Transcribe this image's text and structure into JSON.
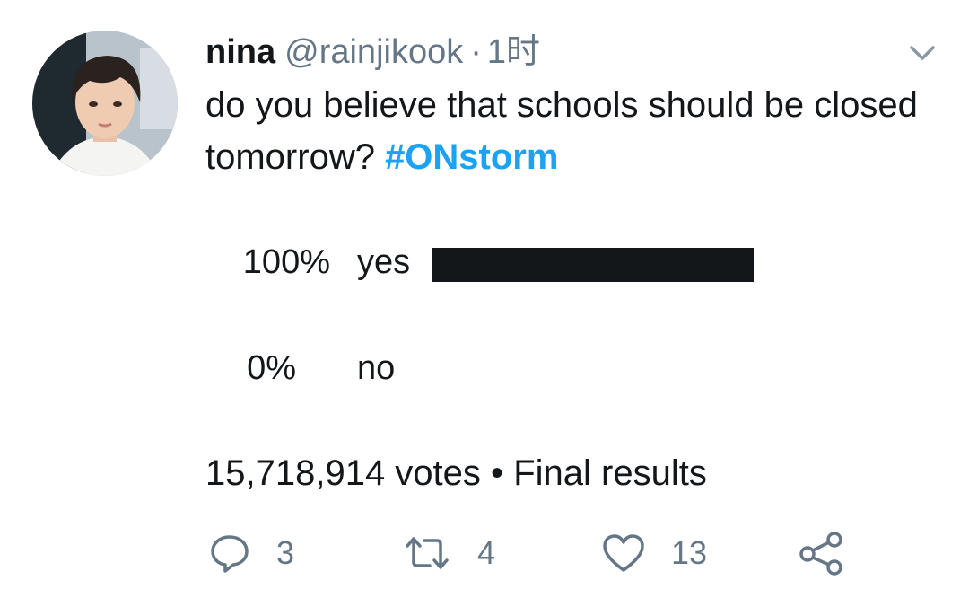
{
  "tweet": {
    "display_name": "nina",
    "handle": "@rainjikook",
    "separator": "·",
    "timestamp": "1时",
    "text": "do you believe that schools should be closed tomorrow? ",
    "hashtag": "#ONstorm"
  },
  "poll": {
    "options": [
      {
        "percent_label": "100%",
        "label": "yes",
        "share": 1.0
      },
      {
        "percent_label": "0%",
        "label": "no",
        "share": 0.0
      }
    ],
    "votes": "15,718,914 votes",
    "bullet": "•",
    "status": "Final results"
  },
  "actions": {
    "reply_count": "3",
    "retweet_count": "4",
    "like_count": "13"
  },
  "colors": {
    "text": "#14171a",
    "secondary": "#657786",
    "link": "#1da1f2",
    "bar": "#14171a"
  },
  "icons": {
    "reply": "reply-icon",
    "retweet": "retweet-icon",
    "like": "heart-icon",
    "share": "share-icon",
    "menu": "chevron-down-icon"
  }
}
